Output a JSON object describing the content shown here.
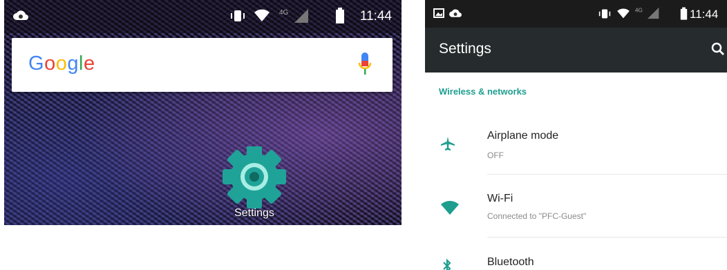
{
  "home": {
    "search_logo": "Google",
    "statusbar": {
      "time": "11:44",
      "network": "4G"
    },
    "apps": [
      {
        "label": "Settings"
      }
    ]
  },
  "settings": {
    "statusbar": {
      "time": "11:44",
      "network": "4G"
    },
    "title": "Settings",
    "section": "Wireless & networks",
    "items": [
      {
        "title": "Airplane mode",
        "subtitle": "OFF",
        "icon": "airplane-icon"
      },
      {
        "title": "Wi-Fi",
        "subtitle": "Connected to \"PFC-Guest\"",
        "icon": "wifi-icon"
      },
      {
        "title": "Bluetooth",
        "icon": "bluetooth-icon"
      }
    ]
  },
  "colors": {
    "accent": "#1e9e8f",
    "toolbar": "#262b2d",
    "settings_icon": "#1fa398"
  }
}
